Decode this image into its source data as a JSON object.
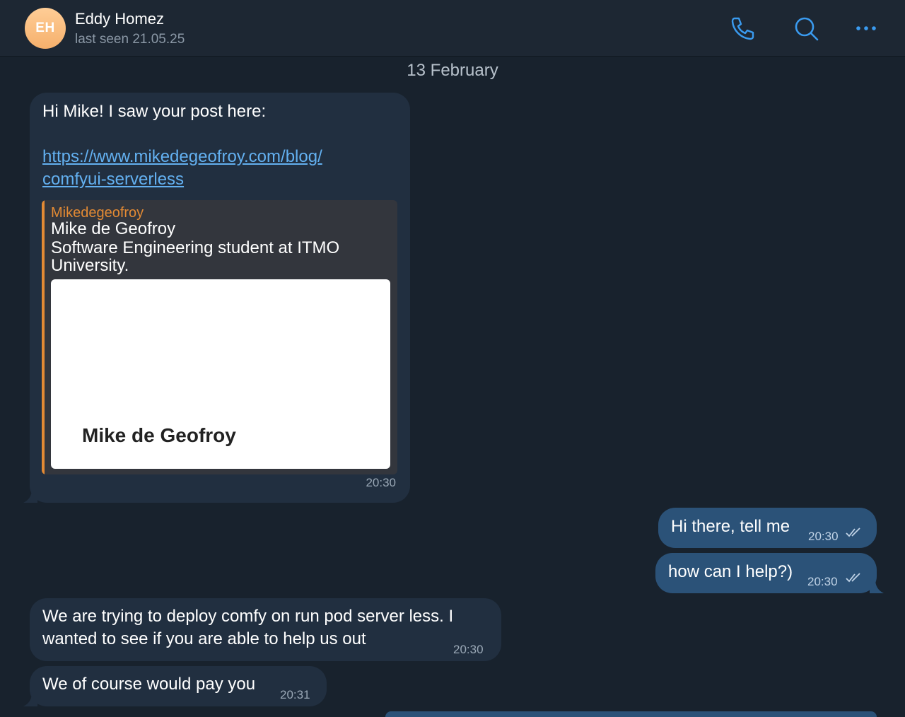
{
  "header": {
    "avatar_initials": "EH",
    "name": "Eddy Homez",
    "status": "last seen 21.05.25",
    "icons": [
      "phone-icon",
      "search-icon",
      "more-icon"
    ]
  },
  "date_separator": "13 February",
  "messages": {
    "m1": {
      "line1": "Hi Mike! I saw your post here:",
      "link_line1": "https://www.mikedegeofroy.com/blog/",
      "link_line2": "comfyui-serverless",
      "preview": {
        "site": "Mikedegeofroy",
        "title": "Mike de Geofroy",
        "description": "Software Engineering student at ITMO University.",
        "image_text": "Mike de Geofroy"
      },
      "time": "20:30"
    },
    "m2": {
      "text": "Hi there, tell me",
      "time": "20:30"
    },
    "m3": {
      "text": "how can I help?)",
      "time": "20:30"
    },
    "m4": {
      "line1": "We are trying to deploy comfy on run pod server less. I",
      "line2": "wanted to see if you are able to help us out",
      "time": "20:30"
    },
    "m5": {
      "text": "We of course would pay you",
      "time": "20:31"
    }
  },
  "colors": {
    "background": "#18222d",
    "incoming": "#212f40",
    "outgoing": "#2b5278",
    "accent": "#3a9bf0",
    "preview_accent": "#e38a34"
  }
}
